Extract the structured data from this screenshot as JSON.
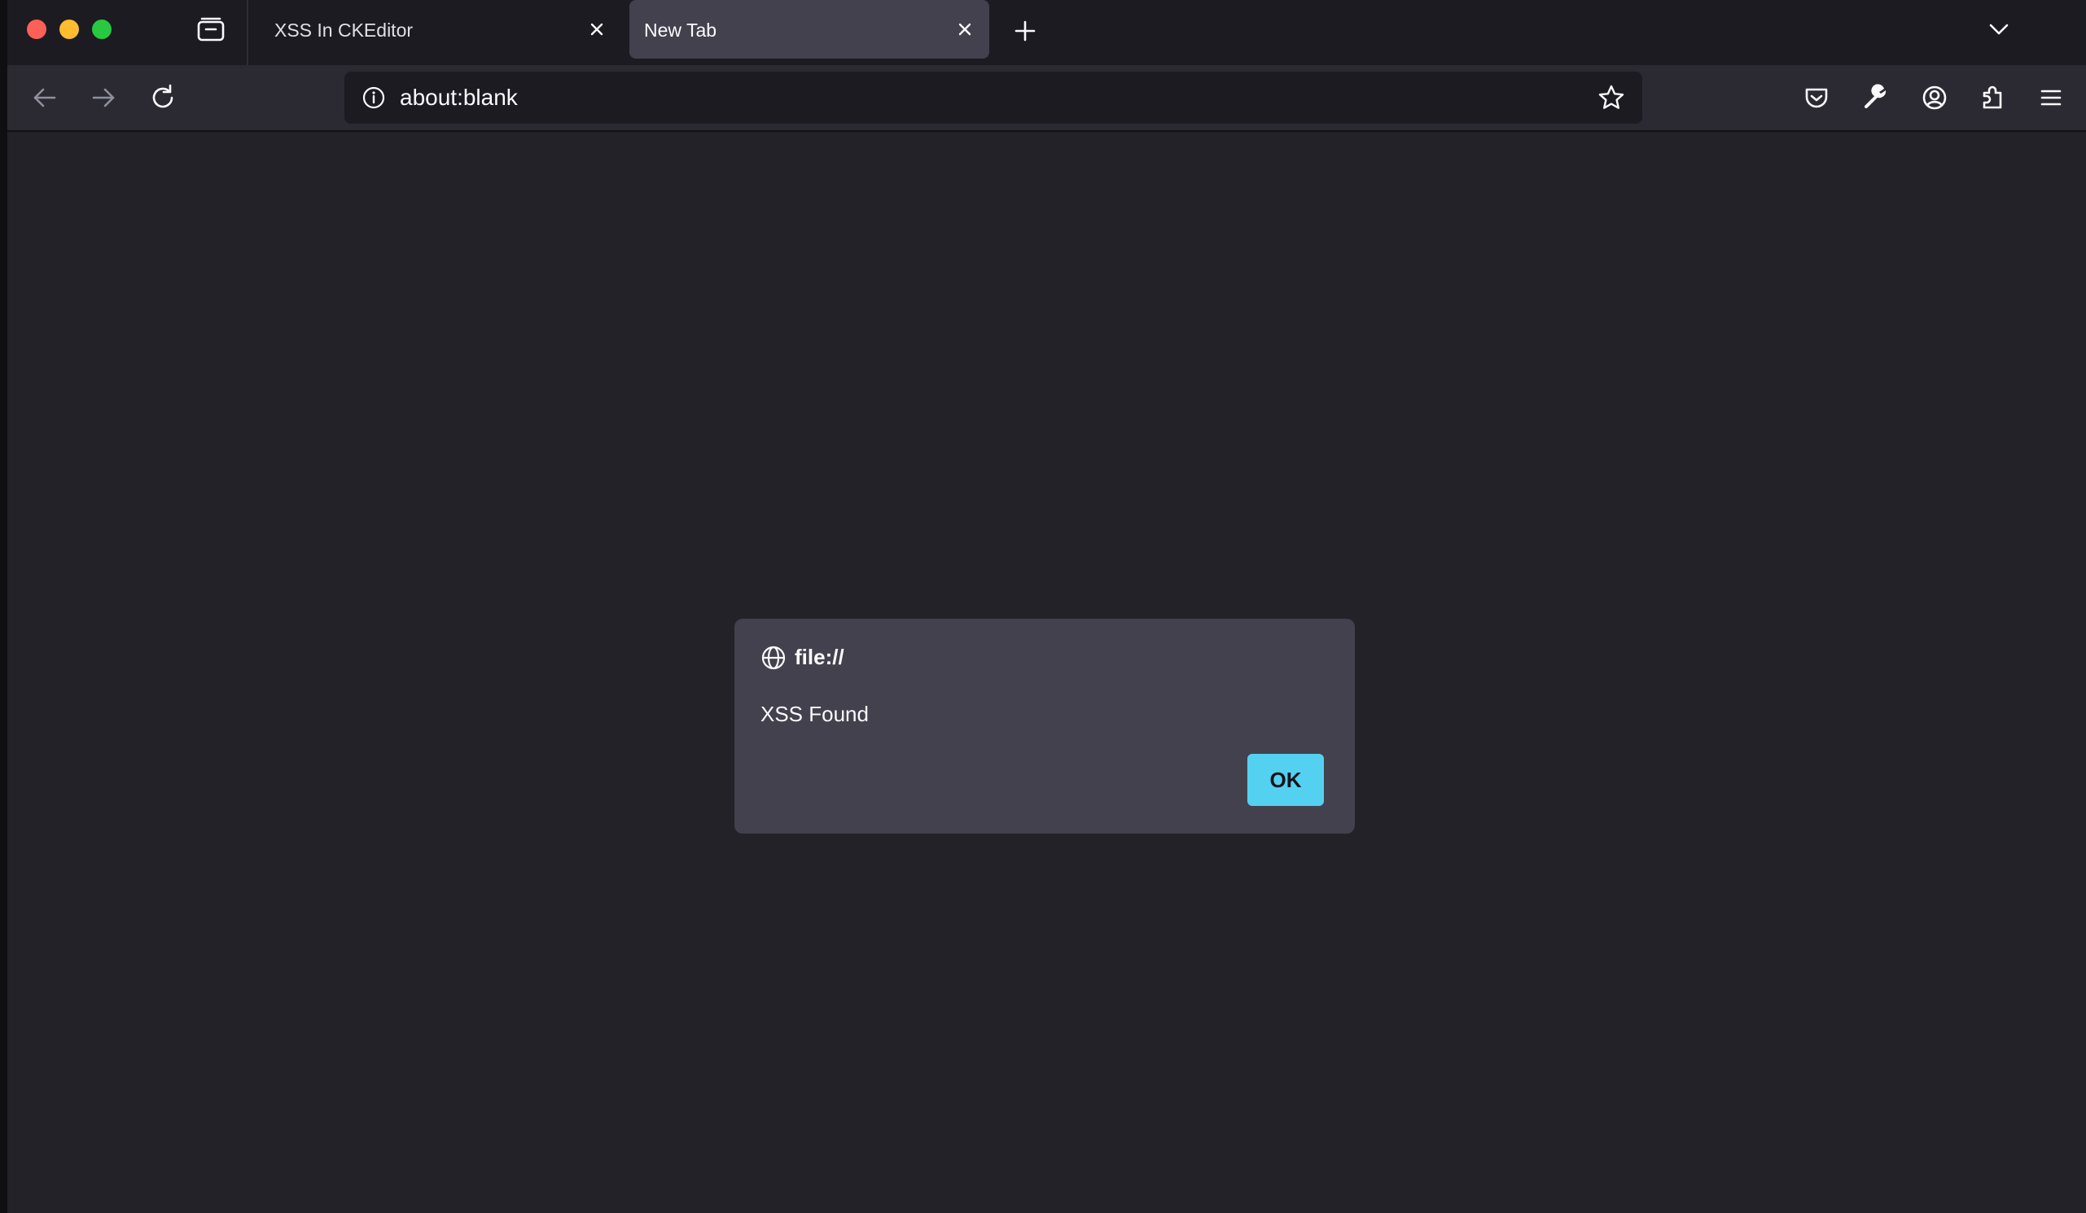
{
  "colors": {
    "accent": "#54d1f1",
    "content_bg": "#232229",
    "toolbar_bg": "#2b2a33",
    "tabbar_bg": "#1c1b22",
    "dialog_bg": "#42414d",
    "close_dot": "#fe5f57",
    "minimize_dot": "#febc2e",
    "zoom_dot": "#28c840"
  },
  "tabs": [
    {
      "label": "XSS In CKEditor",
      "active": false
    },
    {
      "label": "New Tab",
      "active": true
    }
  ],
  "urlbar": {
    "url": "about:blank"
  },
  "icons": {
    "tab_list": "tab-list-icon",
    "close": "close-icon",
    "new_tab": "plus-icon",
    "tabs_menu": "chevron-down-icon",
    "back": "back-arrow-icon",
    "forward": "forward-arrow-icon",
    "reload": "reload-icon",
    "info": "info-icon",
    "bookmark": "star-icon",
    "pocket": "pocket-icon",
    "devtools": "wrench-icon",
    "account": "account-icon",
    "extensions": "puzzle-icon",
    "menu": "hamburger-menu-icon",
    "origin": "globe-icon"
  },
  "dialog": {
    "origin": "file://",
    "message": "XSS Found",
    "ok_label": "OK"
  }
}
